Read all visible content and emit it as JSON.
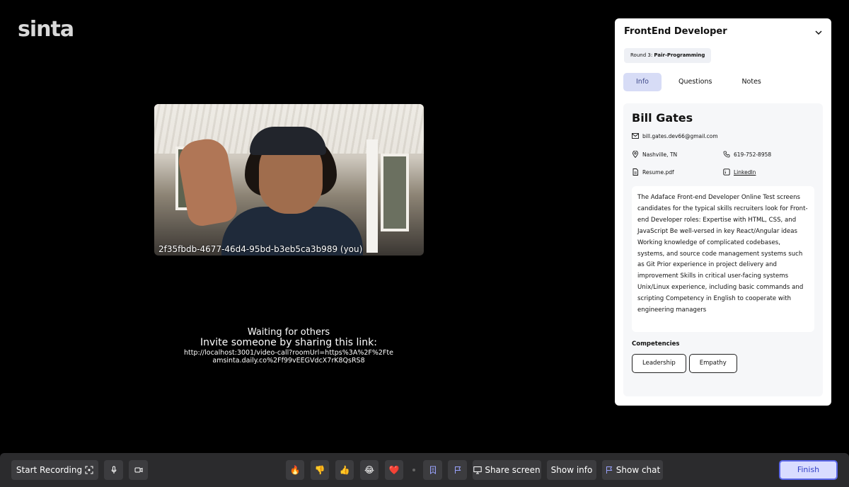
{
  "app": {
    "logo": "sinta"
  },
  "video": {
    "caption": "2f35fbdb-4677-46d4-95bd-b3eb5ca3b989 (you)"
  },
  "waiting": {
    "line1": "Waiting for others",
    "line2": "Invite someone by sharing this link:",
    "link": "http://localhost:3001/video-call?roomUrl=https%3A%2F%2Fteamsinta.daily.co%2Ff99vEEGVdcX7rK8QsRS8"
  },
  "panel": {
    "title": "FrontEnd Developer",
    "round_prefix": "Round 3: ",
    "round_name": "Pair-Programming",
    "tabs": [
      "Info",
      "Questions",
      "Notes"
    ],
    "active_tab": "Info",
    "candidate": {
      "name": "Bill Gates",
      "email": "bill.gates.dev66@gmail.com",
      "location": "Nashville, TN",
      "phone": "619-752-8958",
      "resume": "Resume.pdf",
      "linkedin": "LinkedIn",
      "description": "The Adaface Front-end Developer Online Test screens candidates for the typical skills recruiters look for Front-end Developer roles: Expertise with HTML, CSS, and JavaScript Be well-versed in key React/Angular ideas Working knowledge of complicated codebases, systems, and source code management systems such as Git Prior experience in project delivery and improvement Skills in critical user-facing systems Unix/Linux experience, including basic commands and scripting Competency in English to cooperate with engineering managers",
      "competencies_label": "Competencies",
      "competencies": [
        "Leadership",
        "Empathy"
      ]
    }
  },
  "toolbar": {
    "start_recording": "Start Recording",
    "reactions": [
      "🔥",
      "👎",
      "👍",
      "😂",
      "❤️"
    ],
    "share_screen": "Share screen",
    "show_info": "Show info",
    "show_chat": "Show chat",
    "finish": "Finish"
  },
  "colors": {
    "accent": "#5b67e8",
    "active_tab_bg": "#d7dcf6",
    "toolbar_bg": "#2b2b2d"
  }
}
